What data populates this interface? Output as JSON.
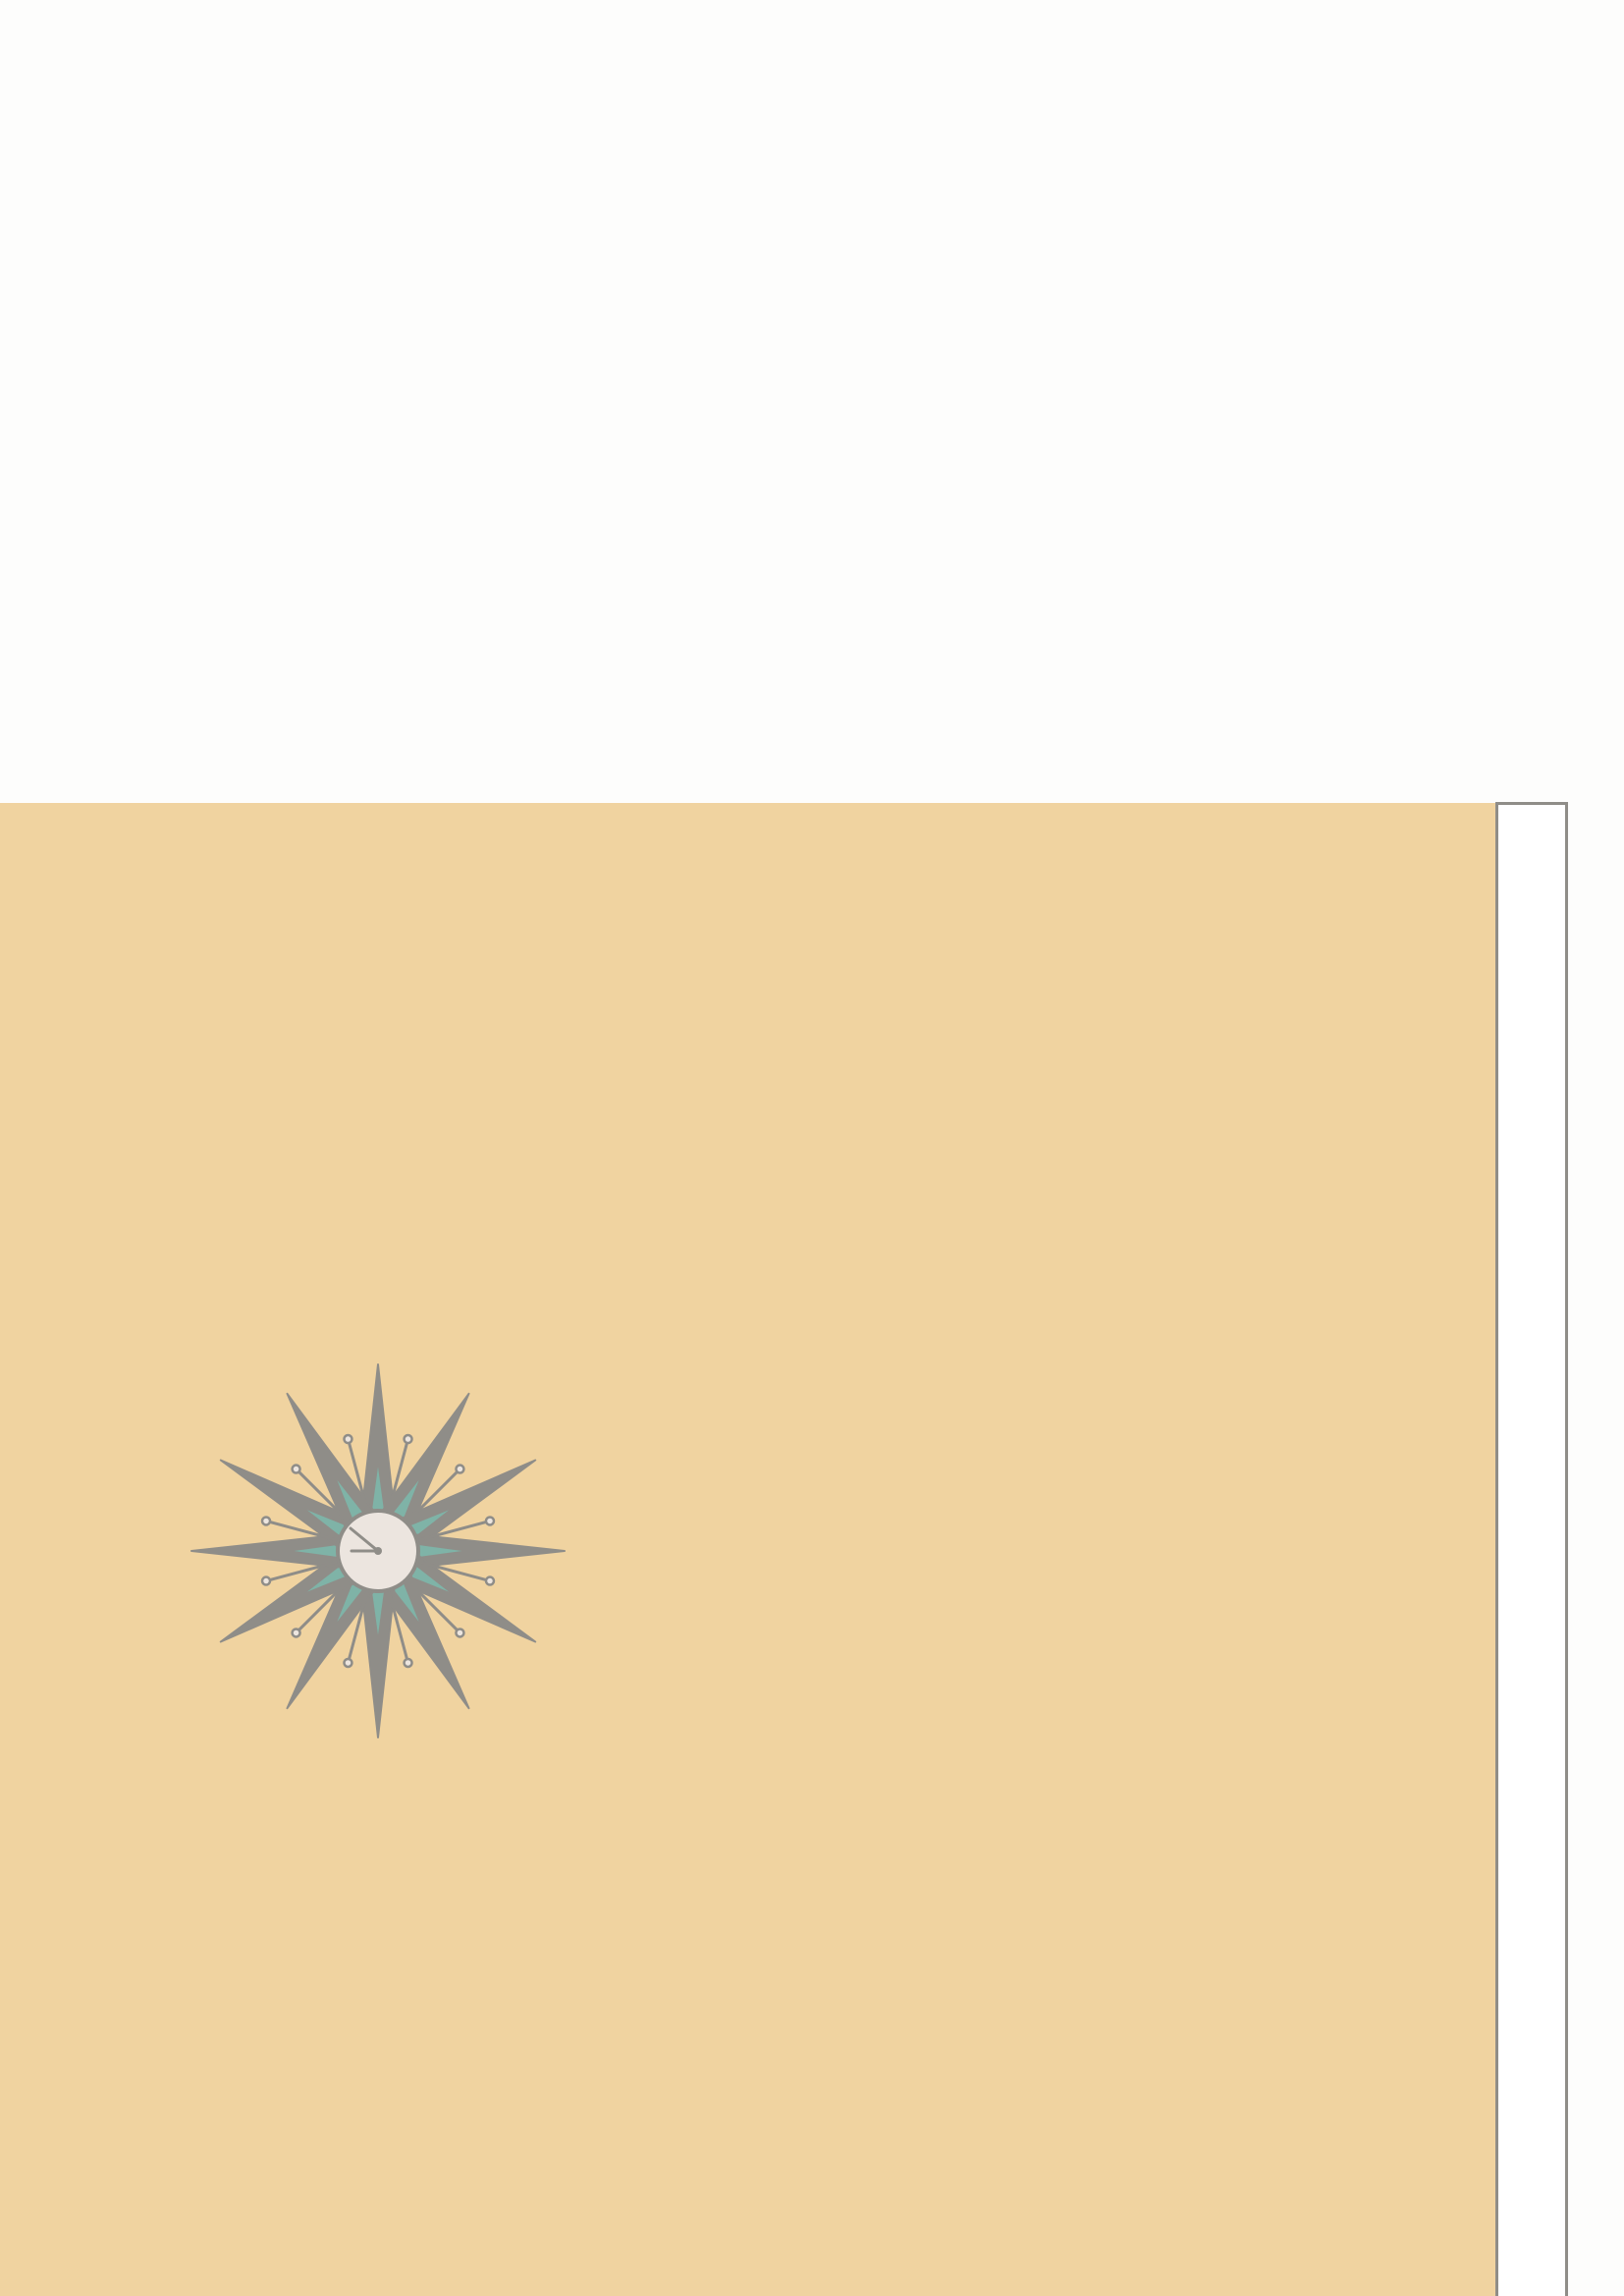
{
  "scene": {
    "wall_color": "#f0d3a0",
    "background_color": "#fdfdfc",
    "door_frame_color": "#8f8d88"
  },
  "clock": {
    "type": "sunburst-wall-clock",
    "spike_color": "#8f8d88",
    "accent_color": "#7fb3a7",
    "face_color": "#ece5df"
  }
}
